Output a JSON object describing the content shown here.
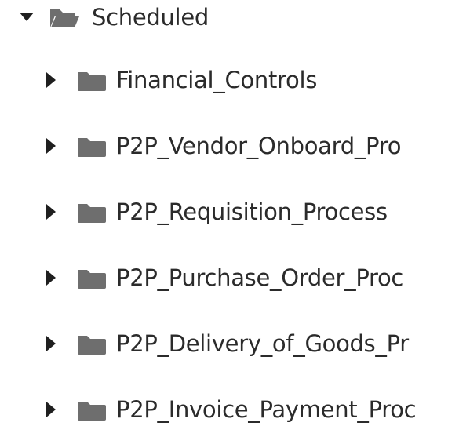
{
  "tree": {
    "root": {
      "label": "Scheduled",
      "expanded": true,
      "icon": "folder-open-icon",
      "caret_icon": "caret-down-icon"
    },
    "children": [
      {
        "label": "Financial_Controls",
        "icon": "folder-icon",
        "caret_icon": "caret-right-icon"
      },
      {
        "label": "P2P_Vendor_Onboard_Pro",
        "icon": "folder-icon",
        "caret_icon": "caret-right-icon"
      },
      {
        "label": "P2P_Requisition_Process",
        "icon": "folder-icon",
        "caret_icon": "caret-right-icon"
      },
      {
        "label": "P2P_Purchase_Order_Proc",
        "icon": "folder-icon",
        "caret_icon": "caret-right-icon"
      },
      {
        "label": "P2P_Delivery_of_Goods_Pr",
        "icon": "folder-icon",
        "caret_icon": "caret-right-icon"
      },
      {
        "label": "P2P_Invoice_Payment_Proc",
        "icon": "folder-icon",
        "caret_icon": "caret-right-icon"
      }
    ]
  },
  "colors": {
    "caret": "#1f1f1f",
    "folder": "#6e6e6e",
    "text": "#2b2b2b"
  }
}
